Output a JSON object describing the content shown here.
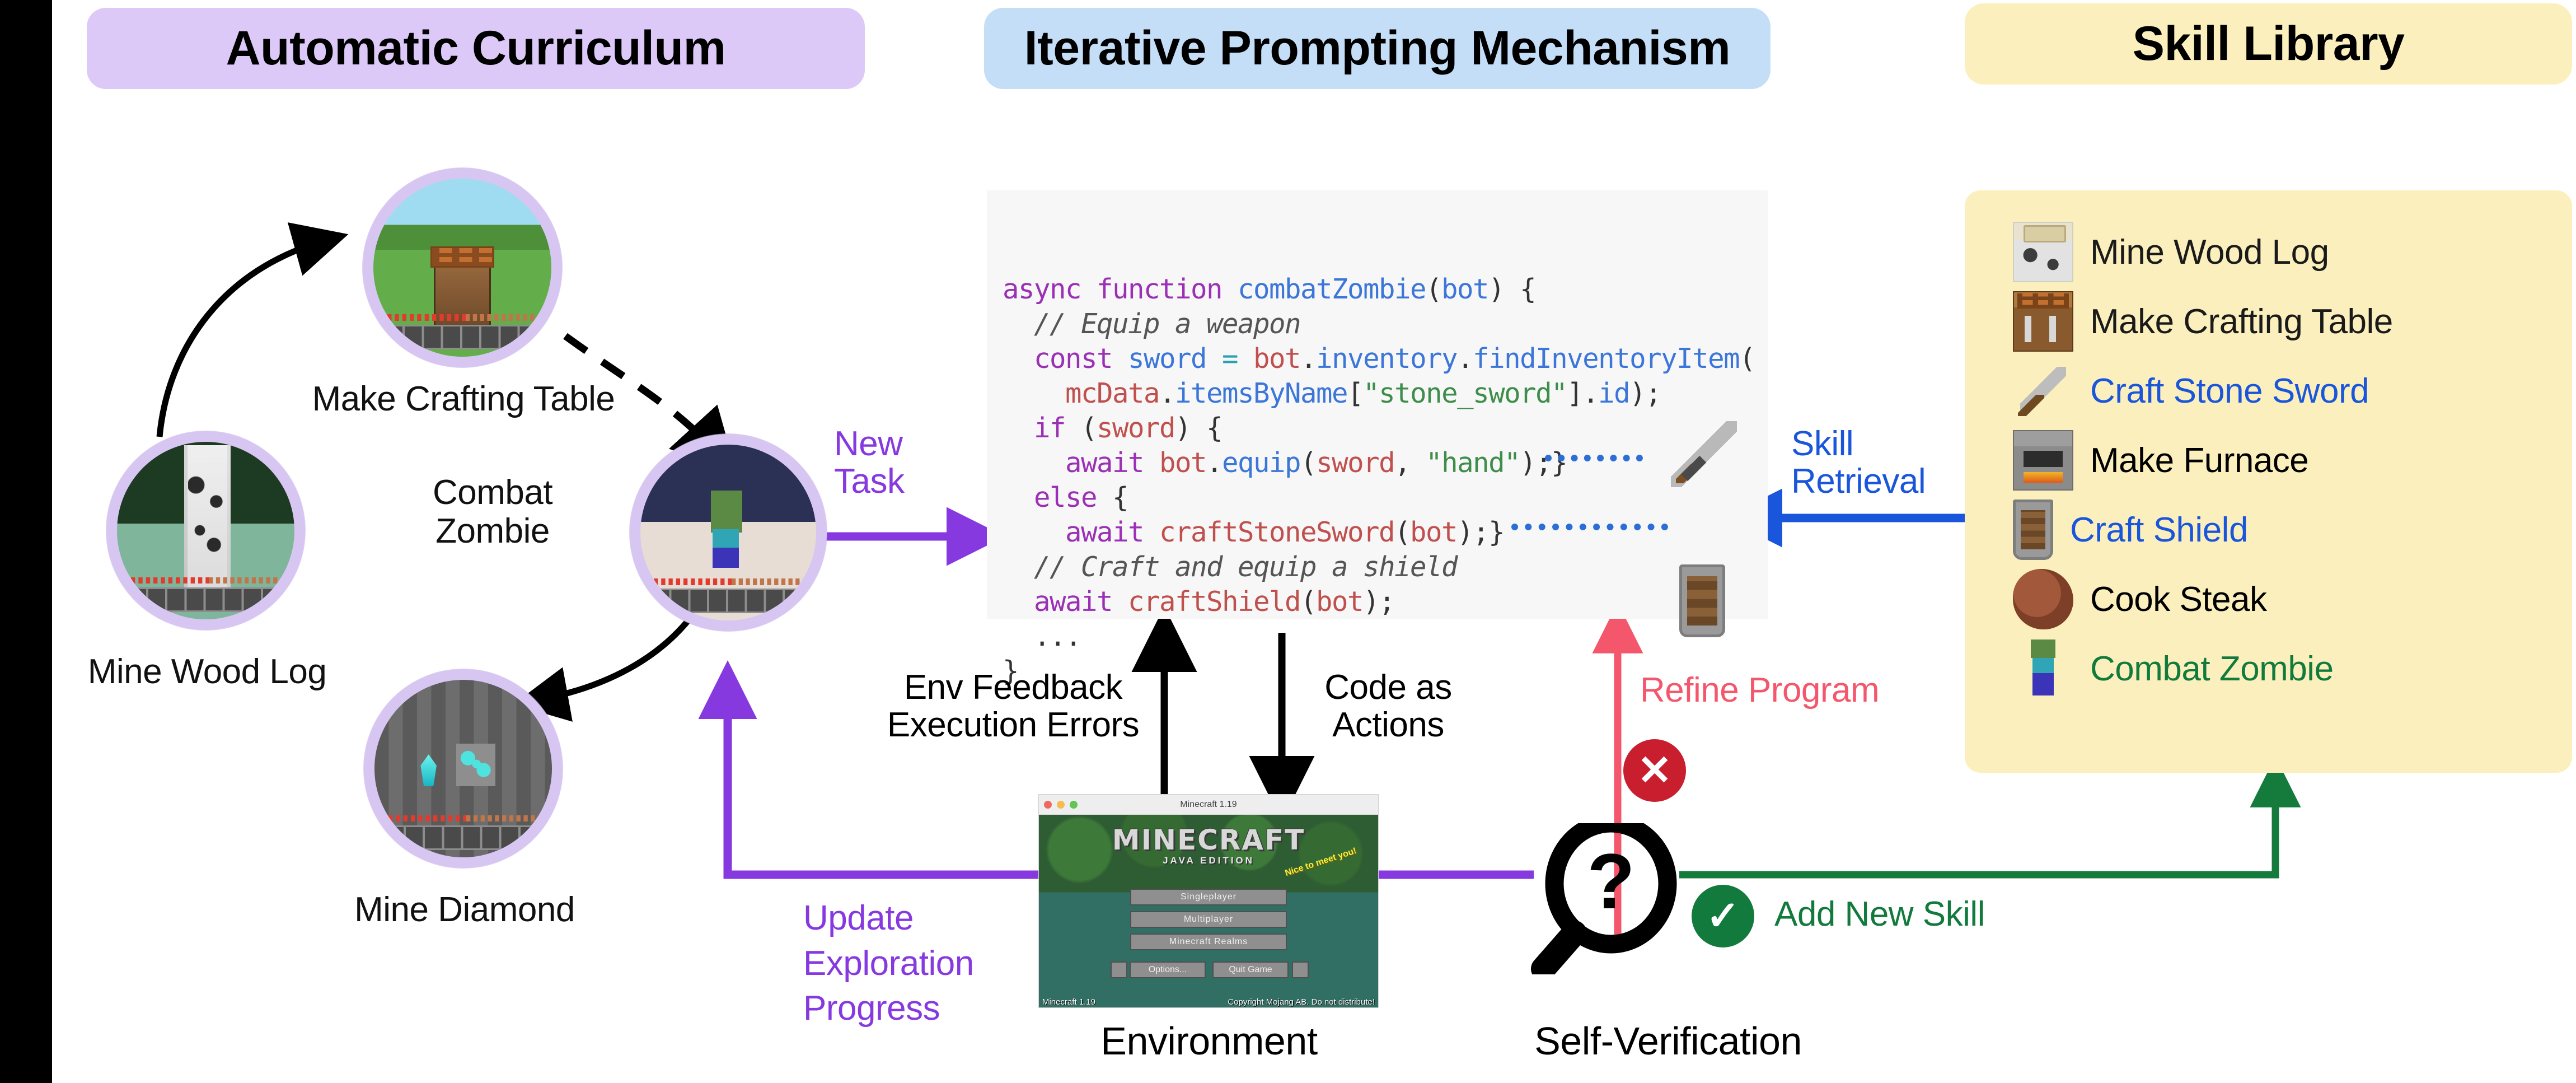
{
  "sections": {
    "curriculum_title": "Automatic Curriculum",
    "prompting_title": "Iterative Prompting Mechanism",
    "skill_title": "Skill Library"
  },
  "curriculum": {
    "nodes": [
      {
        "id": "mine-wood-log",
        "label": "Mine Wood Log",
        "scene": "sc-wood"
      },
      {
        "id": "make-crafting-table",
        "label": "Make Crafting Table",
        "scene": "sc-table"
      },
      {
        "id": "combat-zombie",
        "label": "Combat\nZombie",
        "scene": "sc-zombie"
      },
      {
        "id": "mine-diamond",
        "label": "Mine Diamond",
        "scene": "sc-diamond"
      }
    ]
  },
  "code": {
    "lines": [
      [
        {
          "t": "async function ",
          "c": "kw"
        },
        {
          "t": "combatZombie",
          "c": "fn"
        },
        {
          "t": "(",
          "c": "pl"
        },
        {
          "t": "bot",
          "c": "prop"
        },
        {
          "t": ") {",
          "c": "pl"
        }
      ],
      [
        {
          "t": "  // Equip a weapon",
          "c": "cmt"
        }
      ],
      [
        {
          "t": "  const ",
          "c": "kw"
        },
        {
          "t": "sword ",
          "c": "prop"
        },
        {
          "t": "= ",
          "c": "op"
        },
        {
          "t": "bot",
          "c": "var"
        },
        {
          "t": ".",
          "c": "pl"
        },
        {
          "t": "inventory",
          "c": "prop"
        },
        {
          "t": ".",
          "c": "pl"
        },
        {
          "t": "findInventoryItem",
          "c": "prop"
        },
        {
          "t": "(",
          "c": "pl"
        }
      ],
      [
        {
          "t": "    mcData",
          "c": "var"
        },
        {
          "t": ".",
          "c": "pl"
        },
        {
          "t": "itemsByName",
          "c": "prop"
        },
        {
          "t": "[",
          "c": "pl"
        },
        {
          "t": "\"stone_sword\"",
          "c": "str"
        },
        {
          "t": "].",
          "c": "pl"
        },
        {
          "t": "id",
          "c": "prop"
        },
        {
          "t": ");",
          "c": "pl"
        }
      ],
      [
        {
          "t": "  if ",
          "c": "kw"
        },
        {
          "t": "(",
          "c": "pl"
        },
        {
          "t": "sword",
          "c": "var"
        },
        {
          "t": ") {",
          "c": "pl"
        }
      ],
      [
        {
          "t": "    await ",
          "c": "kw"
        },
        {
          "t": "bot",
          "c": "var"
        },
        {
          "t": ".",
          "c": "pl"
        },
        {
          "t": "equip",
          "c": "prop"
        },
        {
          "t": "(",
          "c": "pl"
        },
        {
          "t": "sword",
          "c": "var"
        },
        {
          "t": ", ",
          "c": "pl"
        },
        {
          "t": "\"hand\"",
          "c": "str"
        },
        {
          "t": ");}",
          "c": "pl"
        }
      ],
      [
        {
          "t": "  else ",
          "c": "kw"
        },
        {
          "t": "{",
          "c": "pl"
        }
      ],
      [
        {
          "t": "    await ",
          "c": "kw"
        },
        {
          "t": "craftStoneSword",
          "c": "var"
        },
        {
          "t": "(",
          "c": "pl"
        },
        {
          "t": "bot",
          "c": "var"
        },
        {
          "t": ");}",
          "c": "pl"
        }
      ],
      [
        {
          "t": "  // Craft and equip a shield",
          "c": "cmt"
        }
      ],
      [
        {
          "t": "  await ",
          "c": "kw"
        },
        {
          "t": "craftShield",
          "c": "var"
        },
        {
          "t": "(",
          "c": "pl"
        },
        {
          "t": "bot",
          "c": "var"
        },
        {
          "t": ");",
          "c": "pl"
        }
      ],
      [
        {
          "t": "  ...",
          "c": "pl"
        }
      ],
      [
        {
          "t": "}",
          "c": "pl"
        }
      ]
    ]
  },
  "skills": {
    "items": [
      {
        "label": "Mine Wood  Log",
        "icon": "wood-log-icon",
        "color": "#1a1a1a",
        "icon_class": "ic-log"
      },
      {
        "label": "Make Crafting Table",
        "icon": "crafting-table-icon",
        "color": "#1a1a1a",
        "icon_class": "ic-table"
      },
      {
        "label": "Craft Stone Sword",
        "icon": "stone-sword-icon",
        "color": "#1a56db",
        "icon_class": "ic-sword"
      },
      {
        "label": "Make Furnace",
        "icon": "furnace-icon",
        "color": "#000000",
        "icon_class": "ic-furnace"
      },
      {
        "label": "Craft Shield",
        "icon": "shield-icon",
        "color": "#1a56db",
        "icon_class": "ic-shield"
      },
      {
        "label": "Cook Steak",
        "icon": "steak-icon",
        "color": "#000000",
        "icon_class": "ic-steak"
      },
      {
        "label": "Combat Zombie",
        "icon": "zombie-icon",
        "color": "#127a3c",
        "icon_class": "ic-zombie"
      }
    ]
  },
  "labels": {
    "new_task": "New\nTask",
    "skill_retrieval": "Skill\nRetrieval",
    "env_feedback": "Env Feedback\nExecution Errors",
    "code_as_actions": "Code as\nActions",
    "refine_program": "Refine Program",
    "add_new_skill": "Add New Skill",
    "update_exploration": "Update\nExploration\nProgress",
    "environment": "Environment",
    "self_verification": "Self-Verification"
  },
  "env_window": {
    "title": "Minecraft 1.19",
    "logo": "MINECRAFT",
    "subtitle": "JAVA EDITION",
    "splash": "Nice to meet you!",
    "buttons": [
      "Singleplayer",
      "Multiplayer",
      "Minecraft Realms"
    ],
    "small_buttons": [
      "Options...",
      "Quit Game"
    ],
    "version": "Minecraft 1.19",
    "copyright": "Copyright Mojang AB. Do not distribute!"
  },
  "badges": {
    "error": "✕",
    "success": "✓"
  },
  "colors": {
    "purple_accent": "#8739e0",
    "blue_accent": "#1a56db",
    "red_accent": "#f4576b",
    "green_accent": "#127a3c",
    "pill_purple": "#dcc9f7",
    "pill_blue": "#c5def8",
    "pill_yellow": "#fbf0bd",
    "ring_purple": "#d8c6f2"
  }
}
